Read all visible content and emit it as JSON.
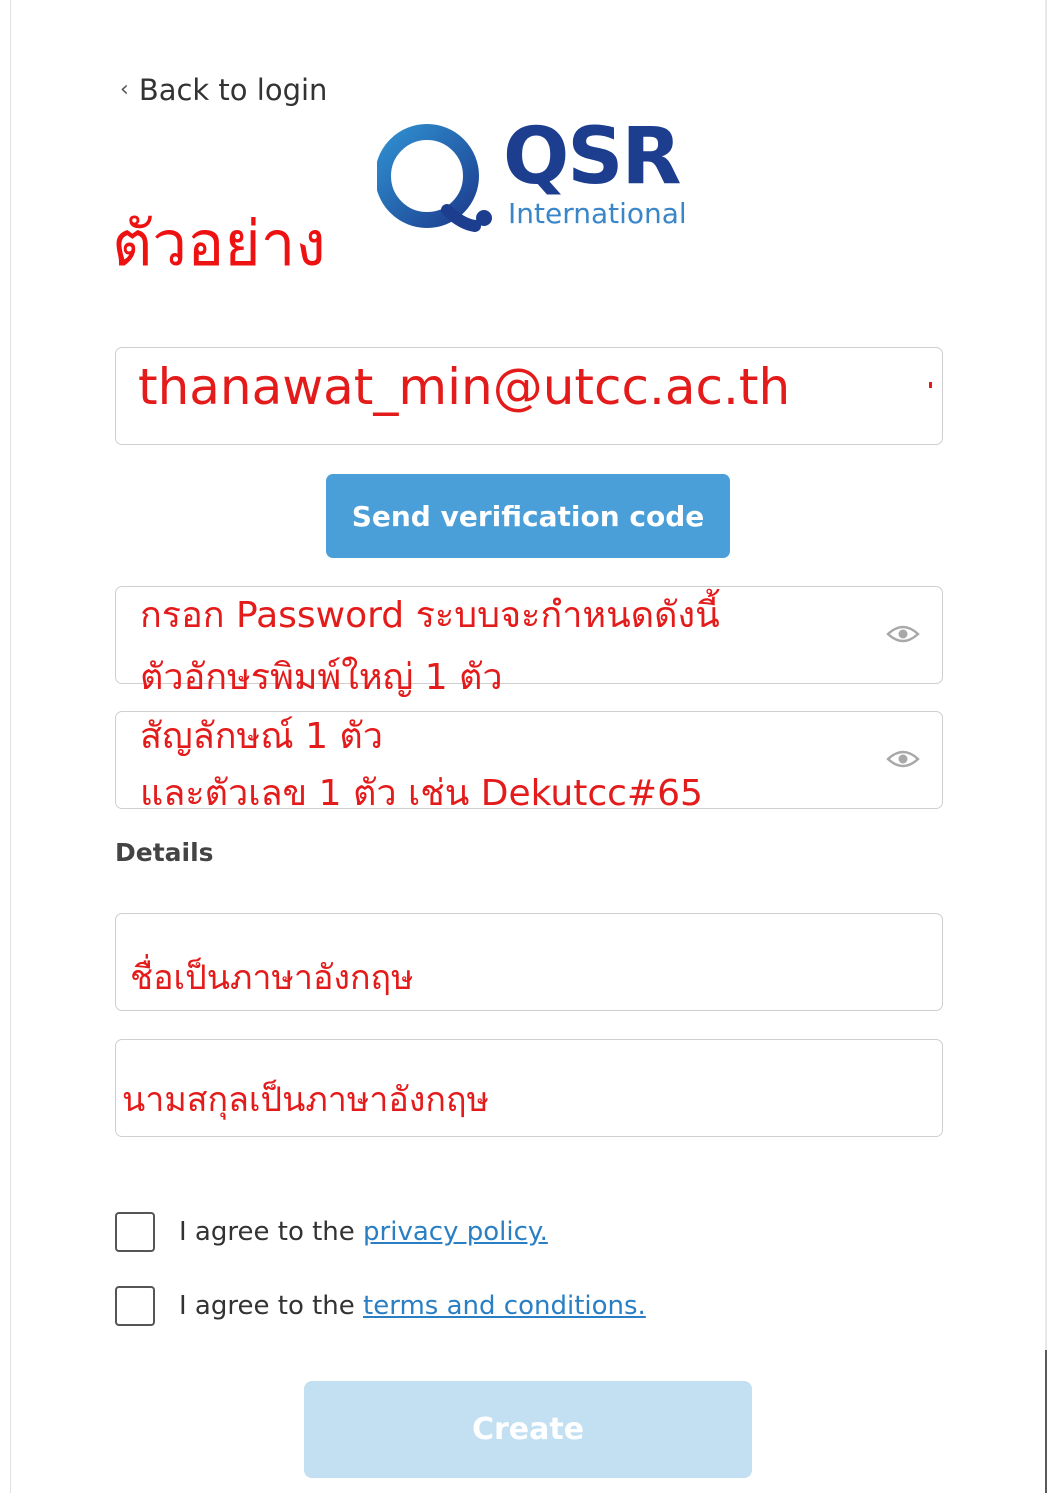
{
  "nav": {
    "back_label": "Back to login"
  },
  "logo": {
    "brand": "QSR",
    "sub": "International"
  },
  "annotation": {
    "sample_label": "ตัวอย่าง"
  },
  "email": {
    "value": "thanawat_min@utcc.ac.th"
  },
  "send_code": {
    "label": "Send verification code"
  },
  "password_note": {
    "line1": "กรอก Password ระบบจะกำหนดดังนี้",
    "line2": "ตัวอักษรพิมพ์ใหญ่ 1 ตัว",
    "line3": "สัญลักษณ์ 1 ตัว",
    "line4": "และตัวเลข 1 ตัว เช่น Dekutcc#65"
  },
  "details": {
    "heading": "Details"
  },
  "first_name": {
    "value": "ชื่อเป็นภาษาอังกฤษ"
  },
  "last_name": {
    "value": "นามสกุลเป็นภาษาอังกฤษ"
  },
  "agreements": {
    "privacy_prefix": "I agree to the ",
    "privacy_link": "privacy policy.",
    "terms_prefix": "I agree to the ",
    "terms_link": "terms and conditions."
  },
  "create": {
    "label": "Create"
  },
  "colors": {
    "accent": "#4a9fd8",
    "annotation_red": "#e31b1b",
    "link": "#2a7fc4",
    "disabled_button": "#c2e0f2"
  },
  "icons": {
    "back": "chevron-left-icon",
    "password_toggle": "eye-icon"
  }
}
